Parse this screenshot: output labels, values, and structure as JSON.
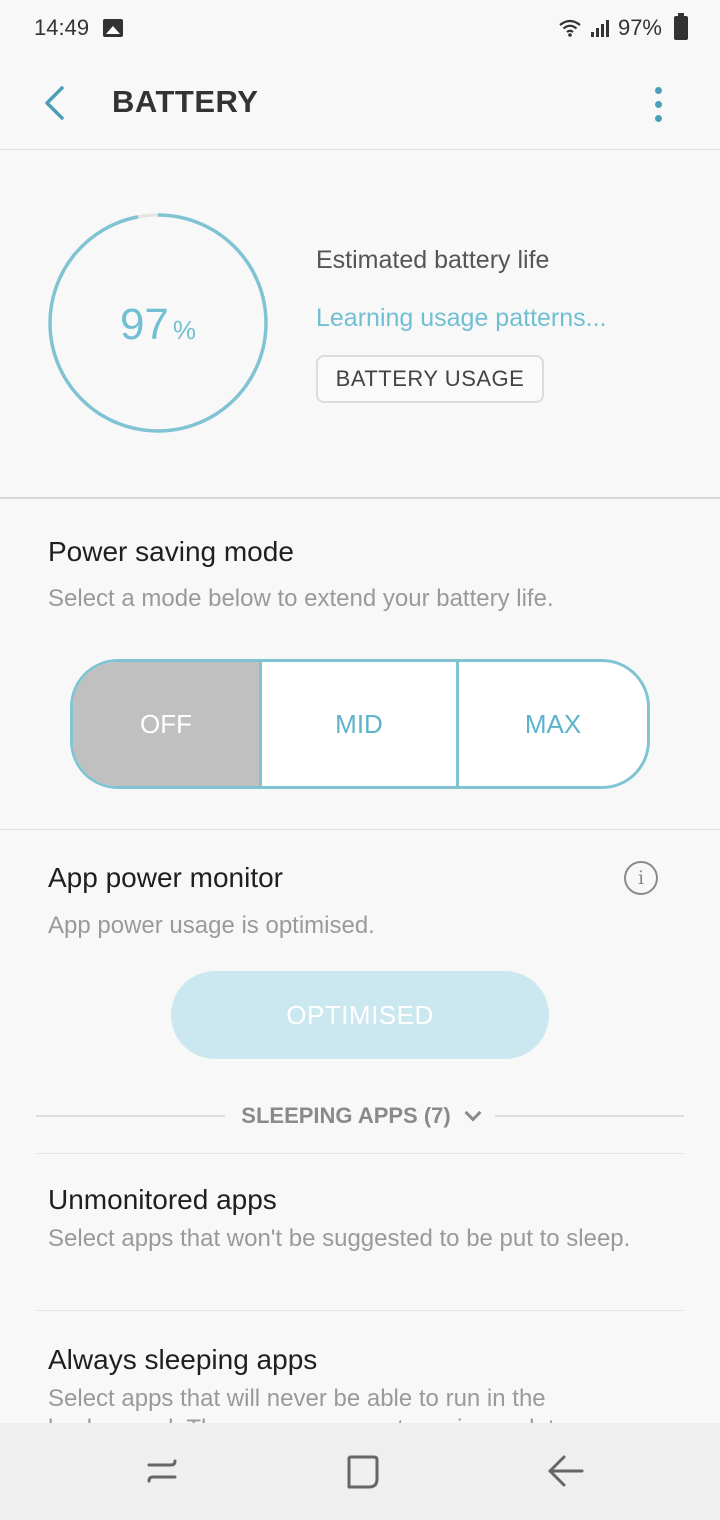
{
  "status_bar": {
    "time": "14:49",
    "battery_text": "97%",
    "icons": [
      "gallery-icon",
      "wifi-icon",
      "signal-icon",
      "battery-icon"
    ]
  },
  "app_bar": {
    "title": "BATTERY",
    "back_icon": "back-arrow-icon",
    "more_icon": "more-vertical-icon"
  },
  "battery": {
    "level_fraction": 0.97,
    "percent_value": "97",
    "percent_unit": "%",
    "estimated_label": "Estimated battery life",
    "learning_text": "Learning usage patterns...",
    "usage_button": "BATTERY USAGE"
  },
  "power_saving": {
    "title": "Power saving mode",
    "subtitle": "Select a mode below to extend your battery life.",
    "modes": [
      "OFF",
      "MID",
      "MAX"
    ],
    "selected": "OFF"
  },
  "app_power_monitor": {
    "title": "App power monitor",
    "subtitle": "App power usage is optimised.",
    "button": "OPTIMISED",
    "sleeping_apps_label": "SLEEPING APPS (7)"
  },
  "list": [
    {
      "title": "Unmonitored apps",
      "subtitle": "Select apps that won't be suggested to be put to sleep."
    },
    {
      "title": "Always sleeping apps",
      "subtitle": "Select apps that will never be able to run in the background. These apps may not receive updates or"
    }
  ],
  "nav_bar": {
    "icons": [
      "recents-icon",
      "home-icon",
      "back-icon"
    ]
  },
  "colors": {
    "accent": "#70bfd3",
    "mode_border": "#80c4d4",
    "selected_mode_bg": "#c0c0c0",
    "optimised_bg": "#cbe7f0"
  }
}
